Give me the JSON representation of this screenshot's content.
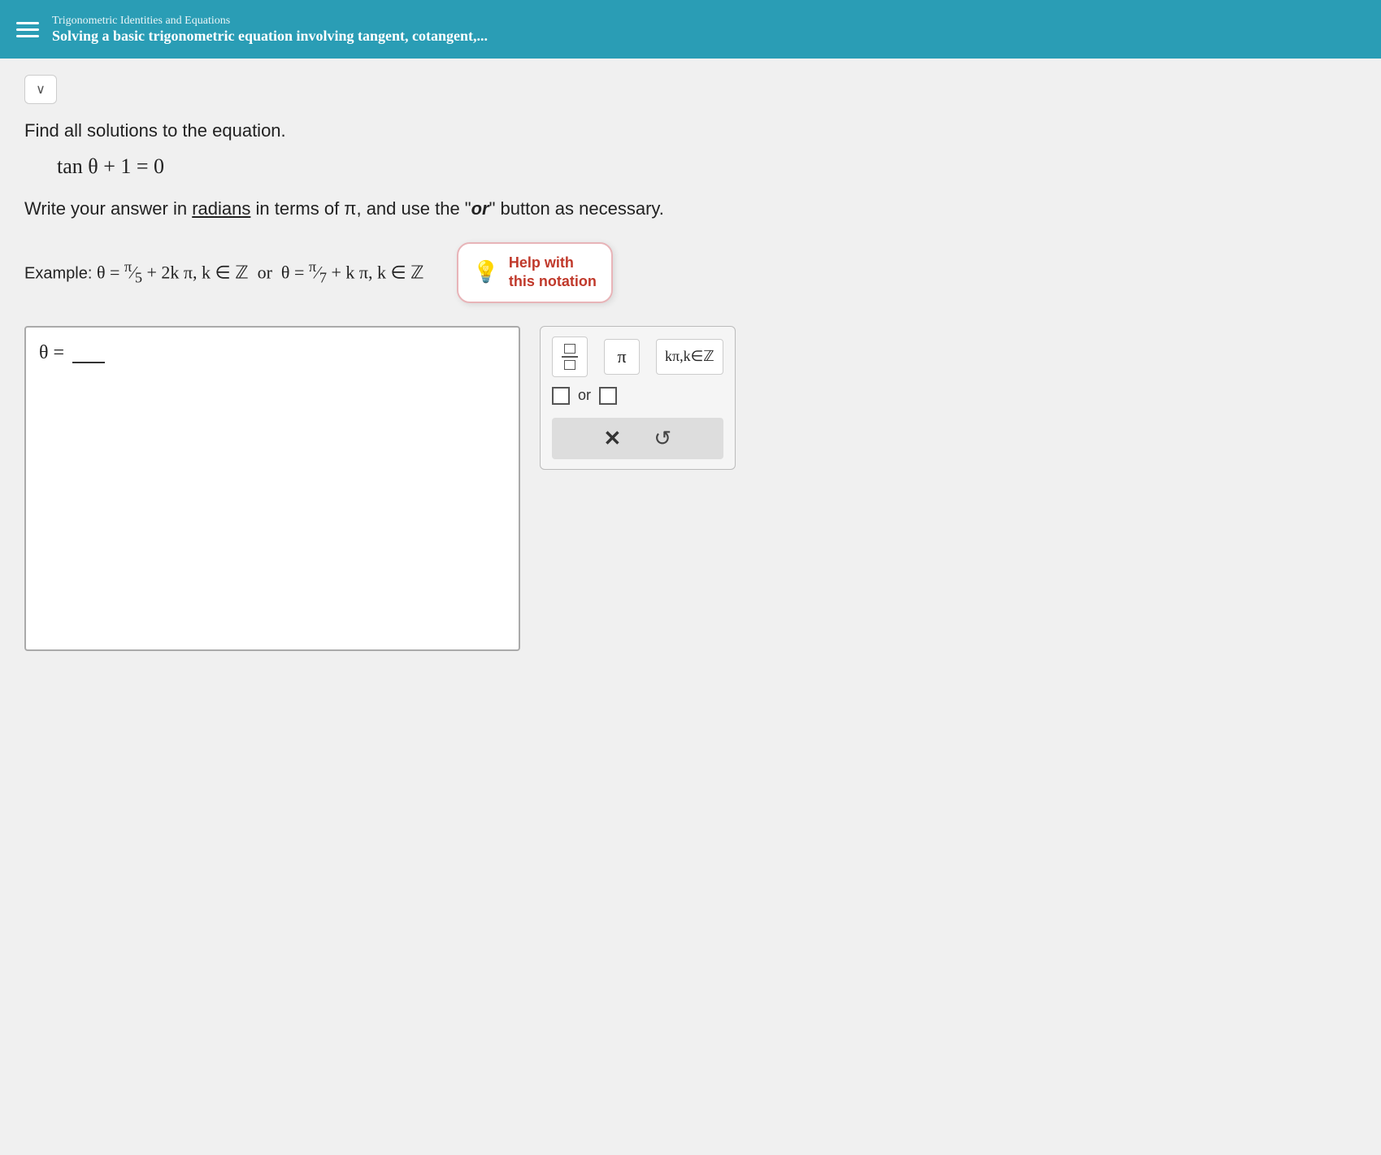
{
  "topbar": {
    "subtitle": "Trigonometric Identities and Equations",
    "title": "Solving a basic trigonometric equation involving tangent, cotangent,..."
  },
  "problem": {
    "find_text": "Find all solutions to the equation.",
    "equation": "tan θ + 1 = 0",
    "instruction": "Write your answer in radians in terms of π, and use the \"or\" button as necessary.",
    "radians_label": "radians",
    "example_label": "Example:",
    "example_expr1": "θ = π/5 + 2kπ, k ∈ ℤ or θ = π/7 + kπ, k ∈ ℤ",
    "help_tooltip": {
      "line1": "Help with",
      "line2": "this notation"
    },
    "answer_prefix": "θ =",
    "answer_placeholder": ""
  },
  "keypad": {
    "fraction_label": "fraction",
    "pi_label": "π",
    "kpi_kez_label": "kπ,k∈ℤ",
    "or_label": "or",
    "clear_label": "×",
    "undo_label": "↺"
  },
  "collapse_btn_label": "∨"
}
